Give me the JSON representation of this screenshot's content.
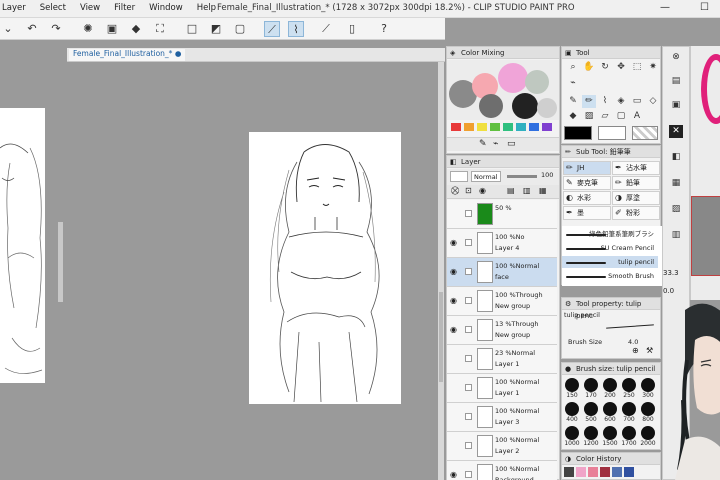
{
  "menu": [
    "Layer",
    "Select",
    "View",
    "Filter",
    "Window",
    "Help"
  ],
  "window_title": "Female_Final_Illustration_* (1728 x 3072px 300dpi 18.2%) - CLIP STUDIO PAINT PRO",
  "window_buttons": {
    "minimize": "—",
    "maximize": "☐"
  },
  "canvas_tab": "Female_Final_Illustration_*",
  "color_mixing": {
    "title": "Color Mixing"
  },
  "palette_colors": [
    "#e83a3a",
    "#f0a030",
    "#f0e040",
    "#60c040",
    "#30c080",
    "#30b0c0",
    "#3070e0",
    "#8040d0"
  ],
  "layer_panel": {
    "title": "Layer",
    "blend_mode": "Normal",
    "opacity": "100",
    "layers": [
      {
        "line1": "50 %",
        "line2": "",
        "selected": false,
        "eye": false,
        "fill": "#1a8a1a"
      },
      {
        "line1": "100 %No",
        "line2": "Layer 4",
        "selected": false,
        "eye": true
      },
      {
        "line1": "100 %Normal",
        "line2": "face",
        "selected": true,
        "eye": true
      },
      {
        "line1": "100 %Through",
        "line2": "New group",
        "selected": false,
        "eye": true
      },
      {
        "line1": "13 %Through",
        "line2": "New group",
        "selected": false,
        "eye": true
      },
      {
        "line1": "23 %Normal",
        "line2": "Layer 1",
        "selected": false,
        "eye": false
      },
      {
        "line1": "100 %Normal",
        "line2": "Layer 1",
        "selected": false,
        "eye": false
      },
      {
        "line1": "100 %Normal",
        "line2": "Layer 3",
        "selected": false,
        "eye": false
      },
      {
        "line1": "100 %Normal",
        "line2": "Layer 2",
        "selected": false,
        "eye": false
      },
      {
        "line1": "100 %Normal",
        "line2": "Background",
        "selected": false,
        "eye": true
      }
    ]
  },
  "tool_panel": {
    "title": "Tool"
  },
  "sub_tool": {
    "title": "Sub Tool: 鉛筆筆",
    "items": [
      "JH",
      "沾水筆",
      "麥克筆",
      "鉛筆",
      "水彩",
      "厚塗",
      "墨",
      "粉彩"
    ],
    "brushes": [
      "綠色鉛筆系筆刷ブラシ",
      "SU Cream Pencil",
      "tulip pencil",
      "Smooth Brush"
    ]
  },
  "tool_property": {
    "title": "Tool property: tulip penc",
    "name": "tulip pencil",
    "brush_size_label": "Brush Size",
    "brush_size_value": "4.0"
  },
  "brush_size_panel": {
    "title": "Brush size: tulip pencil",
    "sizes": [
      "150",
      "170",
      "200",
      "250",
      "300",
      "400",
      "500",
      "600",
      "700",
      "800",
      "1000",
      "1200",
      "1500",
      "1700",
      "2000"
    ]
  },
  "color_history": {
    "title": "Color History"
  },
  "navigator": {
    "values": [
      "33.3",
      "0.0"
    ]
  }
}
